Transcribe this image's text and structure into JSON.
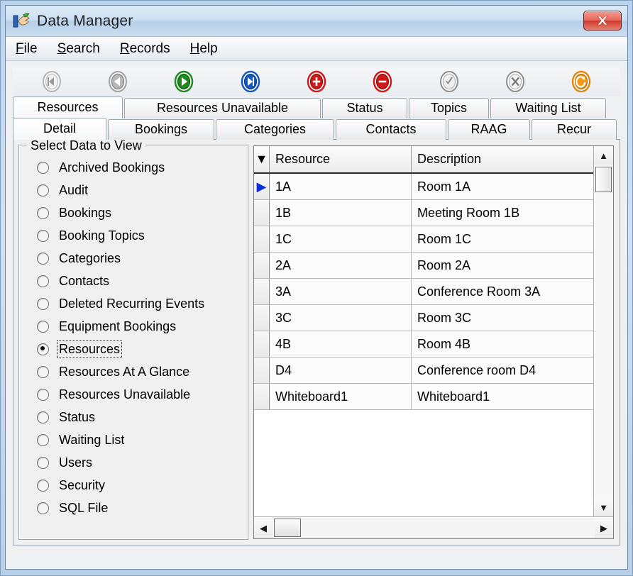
{
  "window": {
    "title": "Data Manager",
    "app_icon": "data-hand-icon",
    "close_label": "X",
    "frame_color": "#b9d3ef",
    "titlebar_color": "#cde0f2",
    "close_button_color": "#cf3a2c"
  },
  "menubar": {
    "items": [
      {
        "label": "File",
        "accel": "F",
        "rest": "ile"
      },
      {
        "label": "Search",
        "accel": "S",
        "rest": "earch"
      },
      {
        "label": "Records",
        "accel": "R",
        "rest": "ecords"
      },
      {
        "label": "Help",
        "accel": "H",
        "rest": "elp"
      }
    ]
  },
  "toolbar": {
    "buttons": [
      {
        "name": "first-record-button",
        "icon": "first-record-icon",
        "color": "#9a9a9a",
        "enabled": false
      },
      {
        "name": "previous-record-button",
        "icon": "previous-record-icon",
        "color": "#8a8a8a",
        "enabled": true
      },
      {
        "name": "next-record-button",
        "icon": "next-record-icon",
        "color": "#1f8a1f",
        "enabled": true
      },
      {
        "name": "last-record-button",
        "icon": "last-record-icon",
        "color": "#1558c0",
        "enabled": true
      },
      {
        "name": "add-record-button",
        "icon": "plus-icon",
        "color": "#d01919",
        "enabled": true
      },
      {
        "name": "delete-record-button",
        "icon": "minus-icon",
        "color": "#d01919",
        "enabled": true
      },
      {
        "name": "post-edit-button",
        "icon": "checkmark-icon",
        "color": "#8e8e8e",
        "enabled": true
      },
      {
        "name": "cancel-edit-button",
        "icon": "cancel-x-icon",
        "color": "#8e8e8e",
        "enabled": true
      },
      {
        "name": "refresh-button",
        "icon": "refresh-icon",
        "color": "#e08a12",
        "enabled": true
      }
    ]
  },
  "tabs": {
    "row1": [
      {
        "label": "Resources",
        "active": true
      },
      {
        "label": "Resources Unavailable",
        "active": false
      },
      {
        "label": "Status",
        "active": false
      },
      {
        "label": "Topics",
        "active": false
      },
      {
        "label": "Waiting List",
        "active": false
      }
    ],
    "row2": [
      {
        "label": "Detail",
        "active": true
      },
      {
        "label": "Bookings",
        "active": false
      },
      {
        "label": "Categories",
        "active": false
      },
      {
        "label": "Contacts",
        "active": false
      },
      {
        "label": "RAAG",
        "active": false
      },
      {
        "label": "Recur",
        "active": false
      }
    ]
  },
  "select_data_group": {
    "title": "Select Data to View",
    "selected": "Resources",
    "options": [
      {
        "label": "Archived Bookings",
        "checked": false,
        "focused": false
      },
      {
        "label": "Audit",
        "checked": false,
        "focused": false
      },
      {
        "label": "Bookings",
        "checked": false,
        "focused": false
      },
      {
        "label": "Booking Topics",
        "checked": false,
        "focused": false
      },
      {
        "label": "Categories",
        "checked": false,
        "focused": false
      },
      {
        "label": "Contacts",
        "checked": false,
        "focused": false
      },
      {
        "label": "Deleted Recurring Events",
        "checked": false,
        "focused": false
      },
      {
        "label": "Equipment Bookings",
        "checked": false,
        "focused": false
      },
      {
        "label": "Resources",
        "checked": true,
        "focused": true
      },
      {
        "label": "Resources At A Glance",
        "checked": false,
        "focused": false
      },
      {
        "label": "Resources Unavailable",
        "checked": false,
        "focused": false
      },
      {
        "label": "Status",
        "checked": false,
        "focused": false
      },
      {
        "label": "Waiting List",
        "checked": false,
        "focused": false
      },
      {
        "label": "Users",
        "checked": false,
        "focused": false
      },
      {
        "label": "Security",
        "checked": false,
        "focused": false
      },
      {
        "label": "SQL File",
        "checked": false,
        "focused": false
      }
    ]
  },
  "grid": {
    "selector_header_glyph": "▼",
    "current_row_glyph": "▶",
    "columns": [
      "Resource",
      "Description"
    ],
    "current_row_index": 0,
    "rows": [
      {
        "resource": "1A",
        "description": "Room 1A",
        "current": true
      },
      {
        "resource": "1B",
        "description": "Meeting Room 1B",
        "current": false
      },
      {
        "resource": "1C",
        "description": "Room 1C",
        "current": false
      },
      {
        "resource": "2A",
        "description": "Room 2A",
        "current": false
      },
      {
        "resource": "3A",
        "description": "Conference Room 3A",
        "current": false
      },
      {
        "resource": "3C",
        "description": "Room 3C",
        "current": false
      },
      {
        "resource": "4B",
        "description": "Room 4B",
        "current": false
      },
      {
        "resource": "D4",
        "description": "Conference room D4",
        "current": false
      },
      {
        "resource": "Whiteboard1",
        "description": "Whiteboard1",
        "current": false
      }
    ],
    "scrollbars": {
      "vertical_up_glyph": "▲",
      "vertical_down_glyph": "▼",
      "horizontal_left_glyph": "◀",
      "horizontal_right_glyph": "▶"
    }
  }
}
